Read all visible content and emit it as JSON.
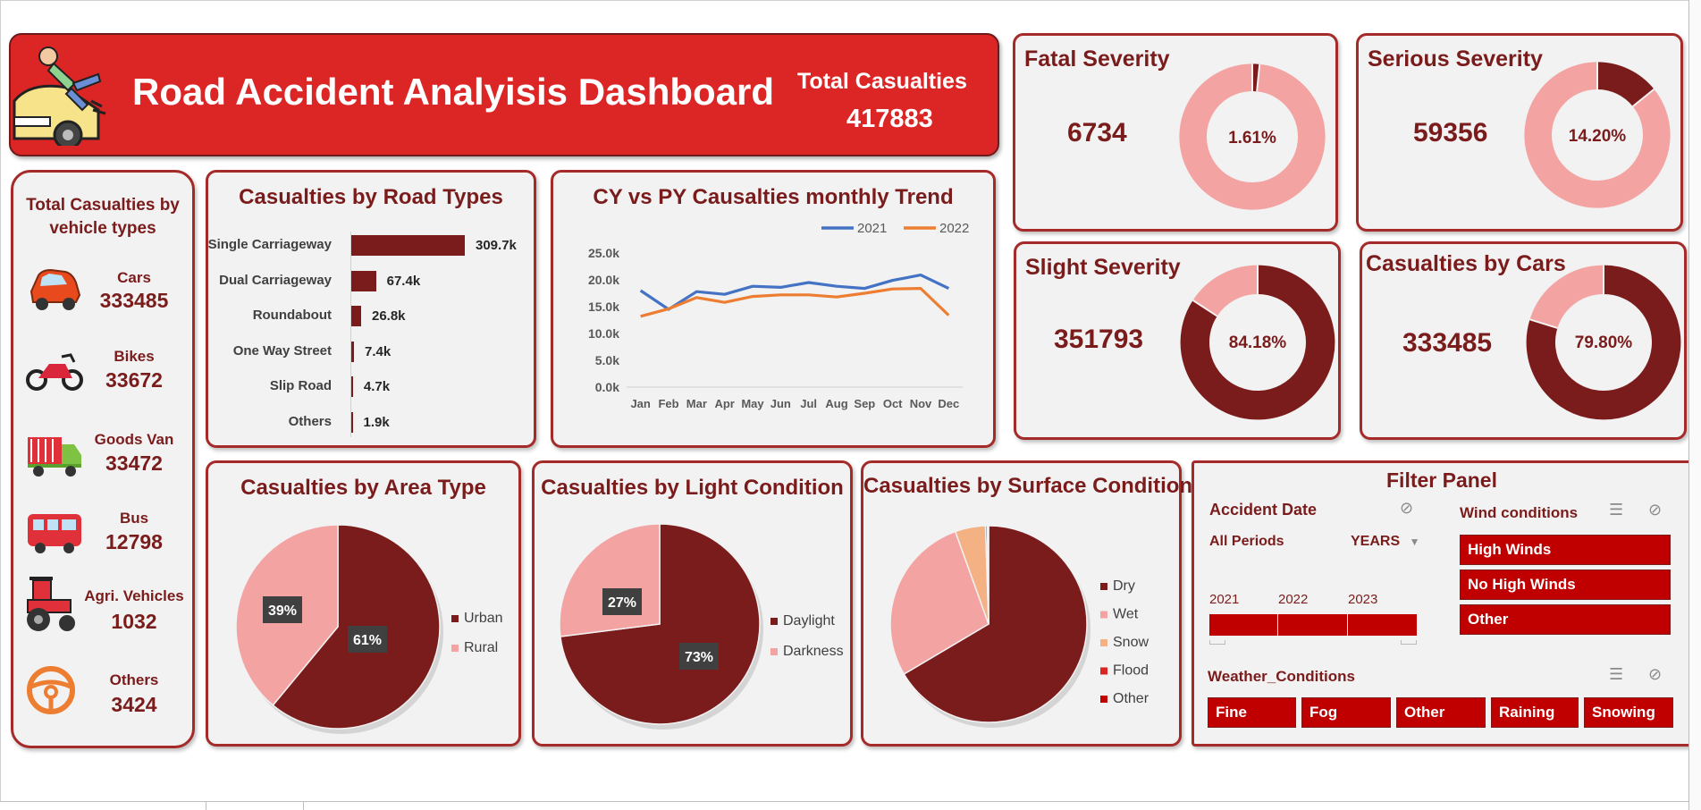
{
  "header": {
    "title": "Road Accident Analyisis Dashboard",
    "total_label": "Total Casualties",
    "total_value": "417883"
  },
  "colors": {
    "dark_red": "#7b1c1c",
    "pink": "#f4a3a3",
    "red": "#dc2626",
    "peach": "#f4b183",
    "blue": "#4472c4",
    "orange": "#ed7d31"
  },
  "kpis": {
    "fatal": {
      "title": "Fatal Severity",
      "value": "6734",
      "pct_label": "1.61%",
      "pct": 1.61
    },
    "serious": {
      "title": "Serious Severity",
      "value": "59356",
      "pct_label": "14.20%",
      "pct": 14.2
    },
    "slight": {
      "title": "Slight Severity",
      "value": "351793",
      "pct_label": "84.18%",
      "pct": 84.18
    },
    "cars": {
      "title": "Casualties by Cars",
      "value": "333485",
      "pct_label": "79.80%",
      "pct": 79.8
    }
  },
  "vehicles": {
    "title": "Total Casualties by vehicle types",
    "items": [
      {
        "label": "Cars",
        "value": "333485",
        "icon": "car-icon"
      },
      {
        "label": "Bikes",
        "value": "33672",
        "icon": "motorbike-icon"
      },
      {
        "label": "Goods Van",
        "value": "33472",
        "icon": "truck-icon"
      },
      {
        "label": "Bus",
        "value": "12798",
        "icon": "bus-icon"
      },
      {
        "label": "Agri. Vehicles",
        "value": "1032",
        "icon": "tractor-icon"
      },
      {
        "label": "Others",
        "value": "3424",
        "icon": "steering-wheel-icon"
      }
    ]
  },
  "road_types": {
    "title": "Casualties by Road Types",
    "rows": [
      {
        "label": "Single Carriageway",
        "value": 309.7,
        "value_label": "309.7k"
      },
      {
        "label": "Dual Carriageway",
        "value": 67.4,
        "value_label": "67.4k"
      },
      {
        "label": "Roundabout",
        "value": 26.8,
        "value_label": "26.8k"
      },
      {
        "label": "One Way Street",
        "value": 7.4,
        "value_label": "7.4k"
      },
      {
        "label": "Slip Road",
        "value": 4.7,
        "value_label": "4.7k"
      },
      {
        "label": "Others",
        "value": 1.9,
        "value_label": "1.9k"
      }
    ]
  },
  "trend": {
    "title": "CY vs PY Causalties monthly Trend"
  },
  "area": {
    "title": "Casualties by Area Type",
    "legend": [
      "Urban",
      "Rural"
    ],
    "labels": [
      "61%",
      "39%"
    ]
  },
  "light": {
    "title": "Casualties by Light Condition",
    "legend": [
      "Daylight",
      "Darkness"
    ],
    "labels": [
      "73%",
      "27%"
    ]
  },
  "surface": {
    "title": "Casualties by Surface Condition",
    "legend": [
      "Dry",
      "Wet",
      "Snow",
      "Flood",
      "Other"
    ]
  },
  "filter_panel": {
    "title": "Filter Panel",
    "accident_date_label": "Accident Date",
    "all_periods": "All Periods",
    "years_label": "YEARS",
    "years": [
      "2021",
      "2022",
      "2023"
    ],
    "wind_label": "Wind conditions",
    "wind_options": [
      "High Winds",
      "No High Winds",
      "Other"
    ],
    "weather_label": "Weather_Conditions",
    "weather_options": [
      "Fine",
      "Fog",
      "Other",
      "Raining",
      "Snowing"
    ]
  },
  "chart_data": [
    {
      "type": "line",
      "title": "CY vs PY Causalties monthly Trend",
      "x": [
        "Jan",
        "Feb",
        "Mar",
        "Apr",
        "May",
        "Jun",
        "Jul",
        "Aug",
        "Sep",
        "Oct",
        "Nov",
        "Dec"
      ],
      "ylim": [
        0,
        25000
      ],
      "yticks": [
        "0.0k",
        "5.0k",
        "10.0k",
        "15.0k",
        "20.0k",
        "25.0k"
      ],
      "legend_position": "top-right",
      "series": [
        {
          "name": "2021",
          "values": [
            18000,
            14500,
            17800,
            17300,
            18800,
            18600,
            19500,
            18800,
            18400,
            19900,
            20900,
            18400
          ]
        },
        {
          "name": "2022",
          "values": [
            13200,
            14600,
            16700,
            15800,
            16900,
            17200,
            17200,
            16800,
            17500,
            18300,
            18400,
            13400
          ]
        }
      ]
    },
    {
      "type": "bar",
      "title": "Casualties by Road Types",
      "categories": [
        "Single Carriageway",
        "Dual Carriageway",
        "Roundabout",
        "One Way Street",
        "Slip Road",
        "Others"
      ],
      "values": [
        309700,
        67400,
        26800,
        7400,
        4700,
        1900
      ]
    },
    {
      "type": "pie",
      "title": "Casualties by Area Type",
      "categories": [
        "Urban",
        "Rural"
      ],
      "values": [
        61,
        39
      ]
    },
    {
      "type": "pie",
      "title": "Casualties by Light Condition",
      "categories": [
        "Daylight",
        "Darkness"
      ],
      "values": [
        73,
        27
      ]
    },
    {
      "type": "pie",
      "title": "Casualties by Surface Condition",
      "categories": [
        "Dry",
        "Wet",
        "Snow",
        "Flood",
        "Other"
      ],
      "values": [
        66.5,
        28.0,
        5.0,
        0.3,
        0.2
      ]
    },
    {
      "type": "pie",
      "title": "Fatal Severity",
      "categories": [
        "Fatal",
        "Other"
      ],
      "values": [
        1.61,
        98.39
      ]
    },
    {
      "type": "pie",
      "title": "Serious Severity",
      "categories": [
        "Serious",
        "Other"
      ],
      "values": [
        14.2,
        85.8
      ]
    },
    {
      "type": "pie",
      "title": "Slight Severity",
      "categories": [
        "Slight",
        "Other"
      ],
      "values": [
        84.18,
        15.82
      ]
    },
    {
      "type": "pie",
      "title": "Casualties by Cars",
      "categories": [
        "Cars",
        "Other"
      ],
      "values": [
        79.8,
        20.2
      ]
    }
  ]
}
